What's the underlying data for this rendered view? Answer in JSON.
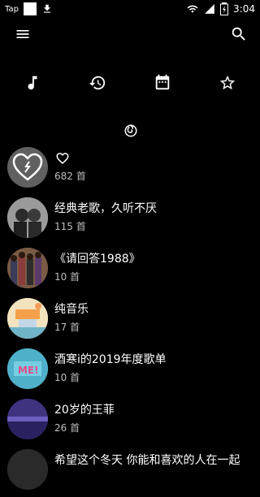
{
  "status_bar": {
    "left_text": "Tap",
    "time": "3:04"
  },
  "icons": {
    "menu": "menu-icon",
    "search": "search-icon",
    "music": "music-note-icon",
    "history": "history-icon",
    "calendar": "calendar-icon",
    "star": "star-icon",
    "logo": "brand-logo-icon"
  },
  "playlists": [
    {
      "title": "",
      "count": "682 首",
      "favorite": true
    },
    {
      "title": "经典老歌，久听不厌",
      "count": "115 首"
    },
    {
      "title": "《请回答1988》",
      "count": "10 首"
    },
    {
      "title": "纯音乐",
      "count": "17 首"
    },
    {
      "title": "酒寒i的2019年度歌单",
      "count": "10 首"
    },
    {
      "title": "20岁的王菲",
      "count": "26 首"
    },
    {
      "title": "希望这个冬天 你能和喜欢的人在一起",
      "count": ""
    }
  ]
}
